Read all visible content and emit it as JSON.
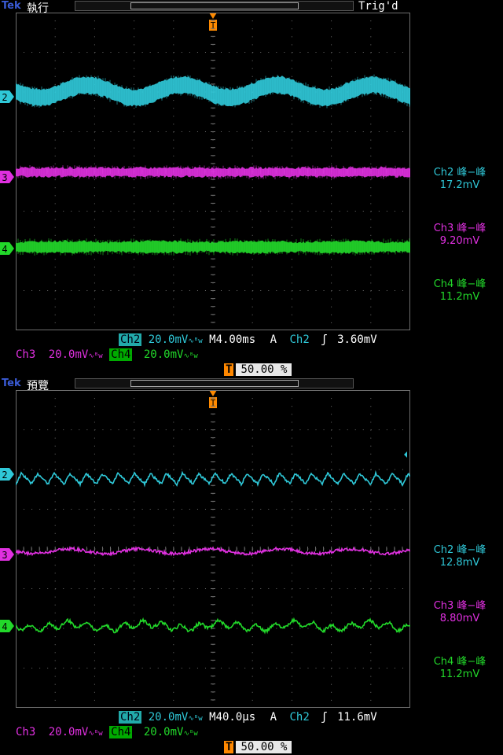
{
  "brand": "Tek",
  "colors": {
    "ch2": "#2fc8d8",
    "ch3": "#e030e0",
    "ch4": "#22d82a",
    "trigger": "#ff8a00",
    "grid": "#6e6e6e"
  },
  "panels": [
    {
      "run_state": "執行",
      "trig_status": "Trig'd",
      "meas_title": {
        "ch2": "Ch2 峰−峰",
        "ch3": "Ch3 峰−峰",
        "ch4": "Ch4 峰−峰"
      },
      "meas_value": {
        "ch2": "17.2mV",
        "ch3": "9.20mV",
        "ch4": "11.2mV"
      },
      "settings": {
        "ch2_label": "Ch2",
        "ch2_scale": "20.0mV",
        "ch3_label": "Ch3",
        "ch3_scale": "20.0mV",
        "ch4_label": "Ch4",
        "ch4_scale": "20.0mV",
        "timebase": "M4.00ms",
        "trig_source_prefix": "A",
        "trig_source": "Ch2",
        "trig_level": "3.60mV"
      },
      "trigger_position": "50.00 %",
      "channel_labels": [
        "2",
        "3",
        "4"
      ]
    },
    {
      "run_state": "預覽",
      "trig_status": "",
      "meas_title": {
        "ch2": "Ch2 峰−峰",
        "ch3": "Ch3 峰−峰",
        "ch4": "Ch4 峰−峰"
      },
      "meas_value": {
        "ch2": "12.8mV",
        "ch3": "8.80mV",
        "ch4": "11.2mV"
      },
      "settings": {
        "ch2_label": "Ch2",
        "ch2_scale": "20.0mV",
        "ch3_label": "Ch3",
        "ch3_scale": "20.0mV",
        "ch4_label": "Ch4",
        "ch4_scale": "20.0mV",
        "timebase": "M40.0µs",
        "trig_source_prefix": "A",
        "trig_source": "Ch2",
        "trig_level": "11.6mV"
      },
      "trigger_position": "50.00 %",
      "channel_labels": [
        "2",
        "3",
        "4"
      ]
    }
  ],
  "trigger_marker_label": "T"
}
